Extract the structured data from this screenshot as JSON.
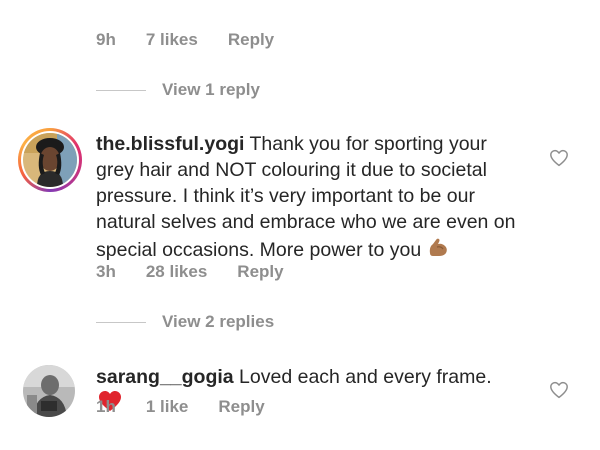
{
  "top_comment": {
    "time": "9h",
    "likes": "7 likes",
    "reply_label": "Reply",
    "view_replies": "View 1 reply"
  },
  "comment1": {
    "username": "the.blissful.yogi",
    "text": " Thank you for sporting your grey hair and NOT colouring it due to societal pressure. I think it’s very important to be our natural selves and embrace who we are even on special occasions. More power to you ",
    "emoji_icon": "flexed-biceps-icon",
    "time": "3h",
    "likes": "28 likes",
    "reply_label": "Reply",
    "view_replies": "View 2 replies"
  },
  "comment2": {
    "username": "sarang__gogia",
    "text": " Loved each and every frame.",
    "emoji_icon": "red-heart-icon",
    "time": "1h",
    "likes": "1 like",
    "reply_label": "Reply"
  },
  "colors": {
    "meta": "#8e8e8e",
    "text": "#262626",
    "heart_emoji": "#e0242d"
  }
}
